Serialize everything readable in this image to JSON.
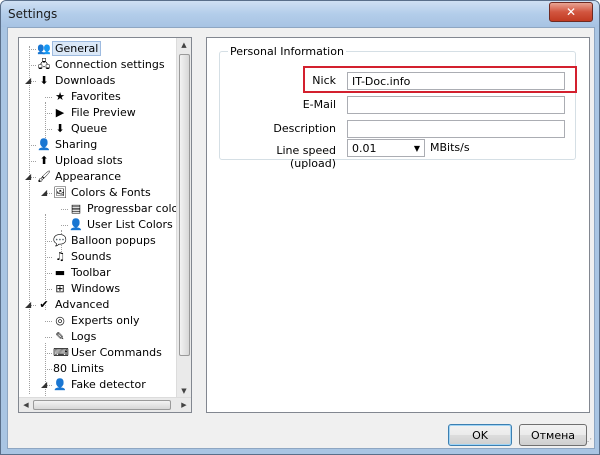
{
  "window": {
    "title": "Settings",
    "close_glyph": "✕"
  },
  "tree": {
    "items": [
      {
        "label": "General",
        "icon": "users-icon",
        "glyph": "👥",
        "selected": true
      },
      {
        "label": "Connection settings",
        "icon": "network-icon",
        "glyph": "🖧"
      },
      {
        "label": "Downloads",
        "icon": "downloads-icon",
        "glyph": "⬇"
      },
      {
        "label": "Favorites",
        "icon": "favorites-icon",
        "glyph": "★"
      },
      {
        "label": "File Preview",
        "icon": "play-icon",
        "glyph": "▶"
      },
      {
        "label": "Queue",
        "icon": "queue-icon",
        "glyph": "⬇"
      },
      {
        "label": "Sharing",
        "icon": "sharing-icon",
        "glyph": "👤"
      },
      {
        "label": "Upload slots",
        "icon": "upload-icon",
        "glyph": "⬆"
      },
      {
        "label": "Appearance",
        "icon": "appearance-icon",
        "glyph": "🖌"
      },
      {
        "label": "Colors & Fonts",
        "icon": "colors-icon",
        "glyph": "🖼"
      },
      {
        "label": "Progressbar colors",
        "icon": "progressbar-icon",
        "glyph": "▤"
      },
      {
        "label": "User List Colors",
        "icon": "user-list-icon",
        "glyph": "👤"
      },
      {
        "label": "Balloon popups",
        "icon": "balloon-icon",
        "glyph": "💬"
      },
      {
        "label": "Sounds",
        "icon": "sound-icon",
        "glyph": "♫"
      },
      {
        "label": "Toolbar",
        "icon": "toolbar-icon",
        "glyph": "▬"
      },
      {
        "label": "Windows",
        "icon": "windows-icon",
        "glyph": "⊞"
      },
      {
        "label": "Advanced",
        "icon": "advanced-icon",
        "glyph": "✔"
      },
      {
        "label": "Experts only",
        "icon": "experts-icon",
        "glyph": "◎"
      },
      {
        "label": "Logs",
        "icon": "logs-icon",
        "glyph": "✎"
      },
      {
        "label": "User Commands",
        "icon": "commands-icon",
        "glyph": "⌨"
      },
      {
        "label": "Limits",
        "icon": "limits-icon",
        "glyph": "80"
      },
      {
        "label": "Fake detector",
        "icon": "fake-detector-icon",
        "glyph": "👤"
      }
    ]
  },
  "personal_info": {
    "group_title": "Personal Information",
    "nick_label": "Nick",
    "nick_value": "IT-Doc.info",
    "email_label": "E-Mail",
    "email_value": "",
    "description_label": "Description",
    "description_value": "",
    "line_speed_label": "Line speed (upload)",
    "line_speed_value": "0.01",
    "line_speed_unit": "MBits/s"
  },
  "buttons": {
    "ok": "OK",
    "cancel": "Отмена"
  },
  "colors": {
    "highlight": "#d3202e",
    "selection": "#dbe8f7"
  }
}
